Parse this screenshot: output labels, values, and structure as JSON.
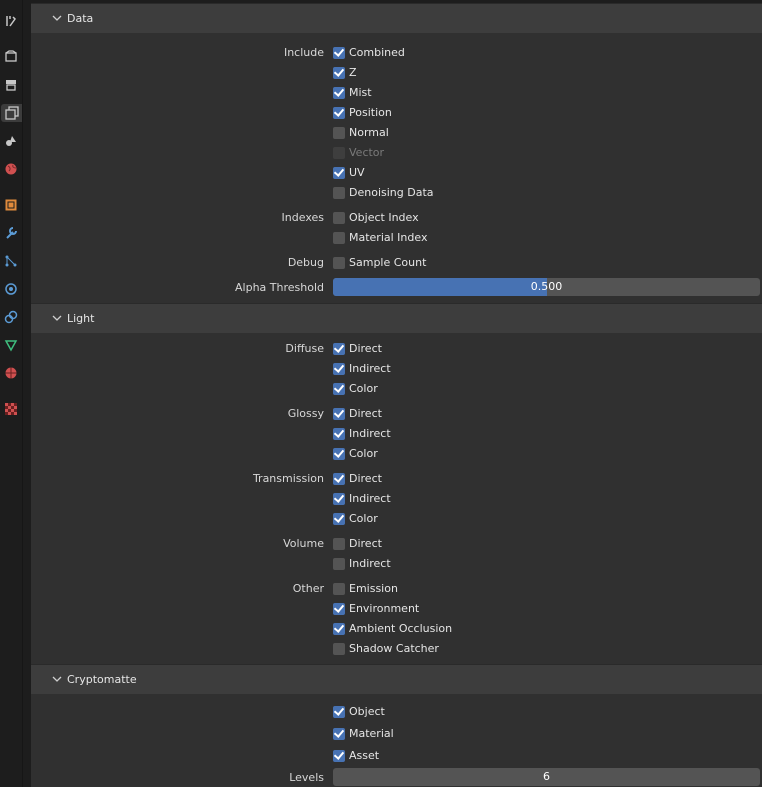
{
  "sidebar": {
    "tabs": [
      {
        "name": "tool-icon",
        "color": "#c8c8c8"
      },
      {
        "name": "render-icon",
        "color": "#c8c8c8"
      },
      {
        "name": "output-icon",
        "color": "#c8c8c8"
      },
      {
        "name": "view-layer-icon",
        "color": "#c8c8c8",
        "active": true
      },
      {
        "name": "scene-icon",
        "color": "#c8c8c8"
      },
      {
        "name": "world-icon",
        "color": "#d05050"
      },
      {
        "name": "object-icon",
        "color": "#e08a3c"
      },
      {
        "name": "modifier-icon",
        "color": "#5b9bd5"
      },
      {
        "name": "particles-icon",
        "color": "#5b9bd5"
      },
      {
        "name": "physics-icon",
        "color": "#5b9bd5"
      },
      {
        "name": "constraints-icon",
        "color": "#5b9bd5"
      },
      {
        "name": "data-icon",
        "color": "#3fbf7f"
      },
      {
        "name": "material-icon",
        "color": "#d05050"
      },
      {
        "name": "texture-icon",
        "color": "#d05050"
      }
    ]
  },
  "data_panel": {
    "title": "Data",
    "include_label": "Include",
    "include": [
      {
        "label": "Combined",
        "checked": true
      },
      {
        "label": "Z",
        "checked": true
      },
      {
        "label": "Mist",
        "checked": true
      },
      {
        "label": "Position",
        "checked": true
      },
      {
        "label": "Normal",
        "checked": false
      },
      {
        "label": "Vector",
        "checked": false,
        "disabled": true
      },
      {
        "label": "UV",
        "checked": true
      },
      {
        "label": "Denoising Data",
        "checked": false
      }
    ],
    "indexes_label": "Indexes",
    "indexes": [
      {
        "label": "Object Index",
        "checked": false
      },
      {
        "label": "Material Index",
        "checked": false
      }
    ],
    "debug_label": "Debug",
    "debug": [
      {
        "label": "Sample Count",
        "checked": false
      }
    ],
    "alpha_threshold_label": "Alpha Threshold",
    "alpha_threshold_value": "0.500",
    "alpha_threshold_fraction": 0.5
  },
  "light_panel": {
    "title": "Light",
    "diffuse_label": "Diffuse",
    "diffuse": [
      {
        "label": "Direct",
        "checked": true
      },
      {
        "label": "Indirect",
        "checked": true
      },
      {
        "label": "Color",
        "checked": true
      }
    ],
    "glossy_label": "Glossy",
    "glossy": [
      {
        "label": "Direct",
        "checked": true
      },
      {
        "label": "Indirect",
        "checked": true
      },
      {
        "label": "Color",
        "checked": true
      }
    ],
    "transmission_label": "Transmission",
    "transmission": [
      {
        "label": "Direct",
        "checked": true
      },
      {
        "label": "Indirect",
        "checked": true
      },
      {
        "label": "Color",
        "checked": true
      }
    ],
    "volume_label": "Volume",
    "volume": [
      {
        "label": "Direct",
        "checked": false
      },
      {
        "label": "Indirect",
        "checked": false
      }
    ],
    "other_label": "Other",
    "other": [
      {
        "label": "Emission",
        "checked": false
      },
      {
        "label": "Environment",
        "checked": true
      },
      {
        "label": "Ambient Occlusion",
        "checked": true
      },
      {
        "label": "Shadow Catcher",
        "checked": false
      }
    ]
  },
  "cryptomatte_panel": {
    "title": "Cryptomatte",
    "items": [
      {
        "label": "Object",
        "checked": true
      },
      {
        "label": "Material",
        "checked": true
      },
      {
        "label": "Asset",
        "checked": true
      }
    ],
    "levels_label": "Levels",
    "levels_value": "6"
  },
  "colors": {
    "accent": "#4772b3",
    "panel_bg": "#303030",
    "header_bg": "#3d3d3d"
  }
}
